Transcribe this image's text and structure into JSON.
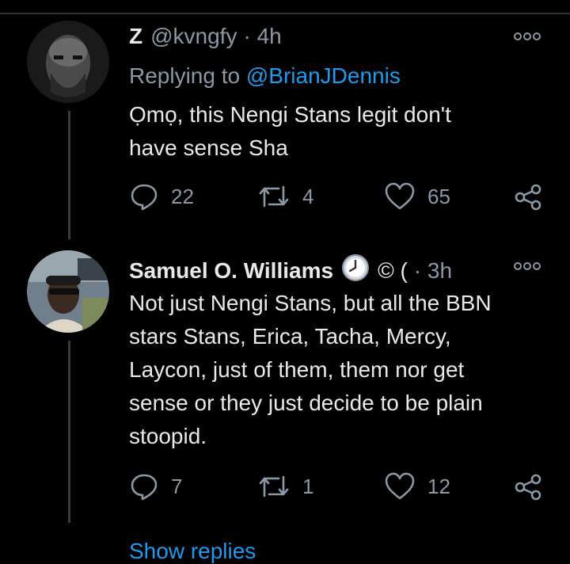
{
  "tweets": [
    {
      "display_name": "Z",
      "handle": "@kvngfy",
      "time": "· 4h",
      "replying_label": "Replying to",
      "replying_handle": "@BrianJDennis",
      "text": "Ọmọ, this Nengi Stans legit don't\nhave sense Sha",
      "replies": "22",
      "retweets": "4",
      "likes": "65"
    },
    {
      "display_name": "Samuel O. Williams",
      "name_suffix": "© (",
      "time": "· 3h",
      "text": "Not just Nengi Stans, but all the BBN\nstars Stans, Erica, Tacha, Mercy,\nLaycon, just of them, them nor get\nsense or they just decide to be plain\nstoopid.",
      "replies": "7",
      "retweets": "1",
      "likes": "12"
    }
  ],
  "show_replies": "Show replies",
  "colors": {
    "background": "#000000",
    "text": "#e7e9ea",
    "muted": "#8b98a5",
    "link": "#1d9bf0"
  },
  "icons": [
    "more-icon",
    "reply-icon",
    "retweet-icon",
    "like-icon",
    "share-icon",
    "clock-icon"
  ]
}
